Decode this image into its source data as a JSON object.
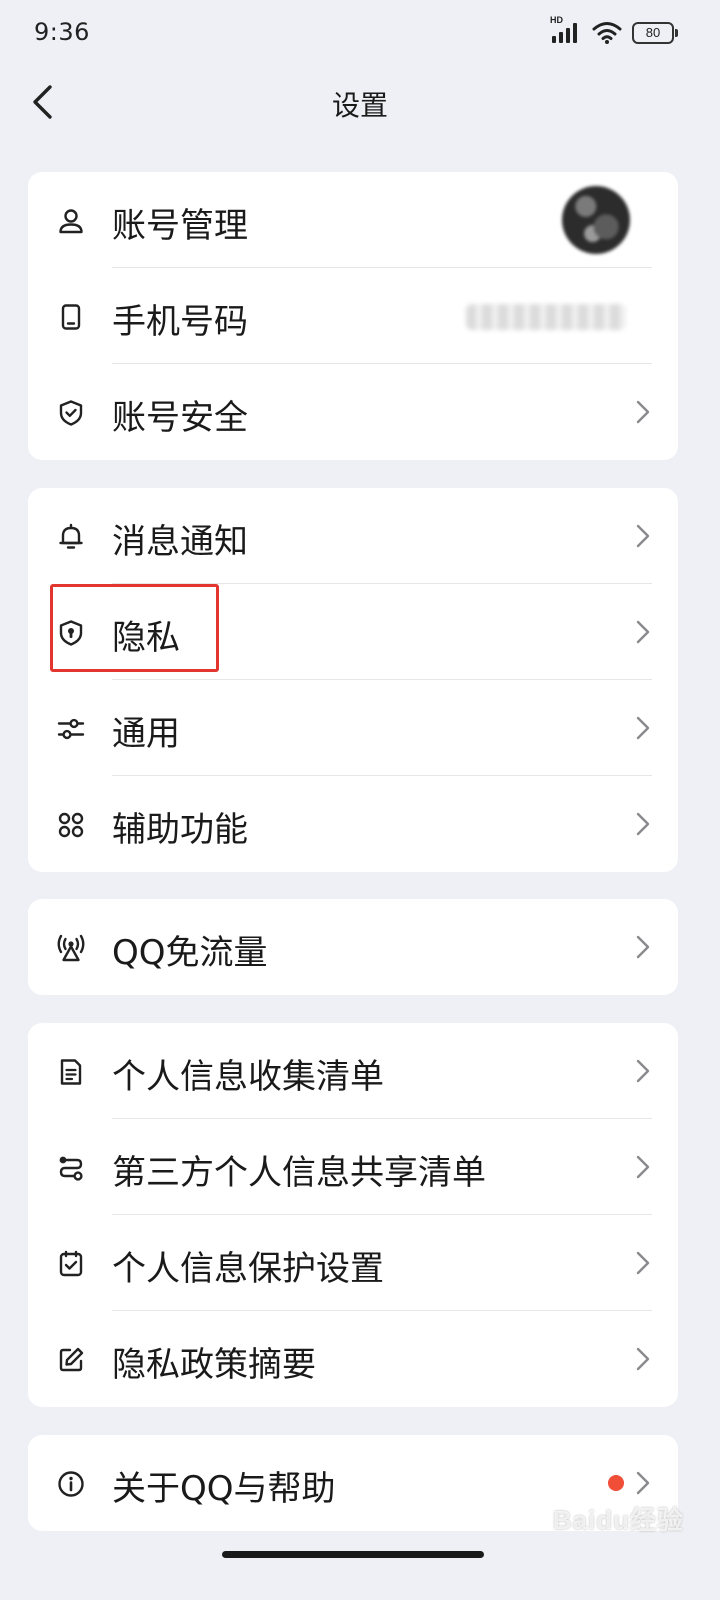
{
  "status_bar": {
    "time": "9:36",
    "network_label": "HD",
    "battery": "80"
  },
  "nav": {
    "title": "设置"
  },
  "groups": [
    {
      "items": [
        {
          "label": "账号管理",
          "icon": "user-icon"
        },
        {
          "label": "手机号码",
          "icon": "phone-icon"
        },
        {
          "label": "账号安全",
          "icon": "shield-check-icon"
        }
      ]
    },
    {
      "items": [
        {
          "label": "消息通知",
          "icon": "bell-icon"
        },
        {
          "label": "隐私",
          "icon": "privacy-shield-icon",
          "highlighted": true
        },
        {
          "label": "通用",
          "icon": "sliders-icon"
        },
        {
          "label": "辅助功能",
          "icon": "grid-icon"
        }
      ]
    },
    {
      "items": [
        {
          "label": "QQ免流量",
          "icon": "signal-tower-icon"
        }
      ]
    },
    {
      "items": [
        {
          "label": "个人信息收集清单",
          "icon": "document-icon"
        },
        {
          "label": "第三方个人信息共享清单",
          "icon": "share-icon"
        },
        {
          "label": "个人信息保护设置",
          "icon": "checkbox-icon"
        },
        {
          "label": "隐私政策摘要",
          "icon": "edit-icon"
        }
      ]
    },
    {
      "items": [
        {
          "label": "关于QQ与帮助",
          "icon": "info-icon",
          "badge": "red-dot"
        }
      ]
    }
  ],
  "colors": {
    "background": "#eff0f5",
    "card": "#ffffff",
    "highlight": "#e1352d",
    "badge": "#f04e37"
  },
  "watermark": "Baidu经验"
}
